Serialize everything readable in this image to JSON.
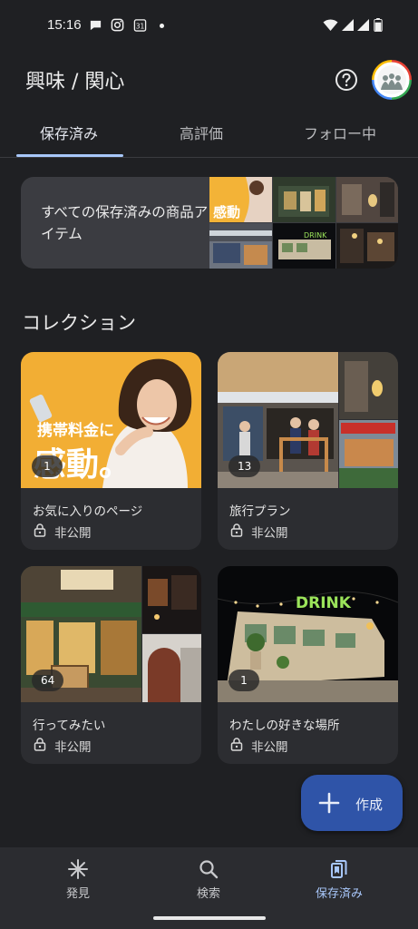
{
  "status_bar": {
    "time": "15:16",
    "calendar_day": "31",
    "icons": [
      "chat-bubble-icon",
      "instagram-icon",
      "calendar-icon",
      "wifi-icon",
      "signal-icon",
      "signal-icon",
      "battery-icon"
    ]
  },
  "header": {
    "title": "興味 / 関心",
    "help_icon": "help-circle-icon",
    "avatar_icon": "profile-avatar-icon"
  },
  "tabs": [
    {
      "label": "保存済み",
      "active": true
    },
    {
      "label": "高評価",
      "active": false
    },
    {
      "label": "フォロー中",
      "active": false
    }
  ],
  "all_saved": {
    "label": "すべての保存済みの商品アイテム"
  },
  "collections_title": "コレクション",
  "collections": [
    {
      "title": "お気に入りのページ",
      "count": "1",
      "privacy": "非公開",
      "image_text": "携帯料金に感動。"
    },
    {
      "title": "旅行プラン",
      "count": "13",
      "privacy": "非公開"
    },
    {
      "title": "行ってみたい",
      "count": "64",
      "privacy": "非公開"
    },
    {
      "title": "わたしの好きな場所",
      "count": "1",
      "privacy": "非公開",
      "image_text": "DRINK"
    }
  ],
  "fab": {
    "label": "作成",
    "icon": "plus-icon"
  },
  "bottom_nav": [
    {
      "label": "発見",
      "icon": "sparkle-icon",
      "active": false
    },
    {
      "label": "検索",
      "icon": "search-icon",
      "active": false
    },
    {
      "label": "保存済み",
      "icon": "saved-collections-icon",
      "active": true
    }
  ],
  "colors": {
    "background": "#1f2023",
    "accent": "#a8c7fa",
    "fab": "#2f54a8",
    "card": "#2c2d31"
  }
}
